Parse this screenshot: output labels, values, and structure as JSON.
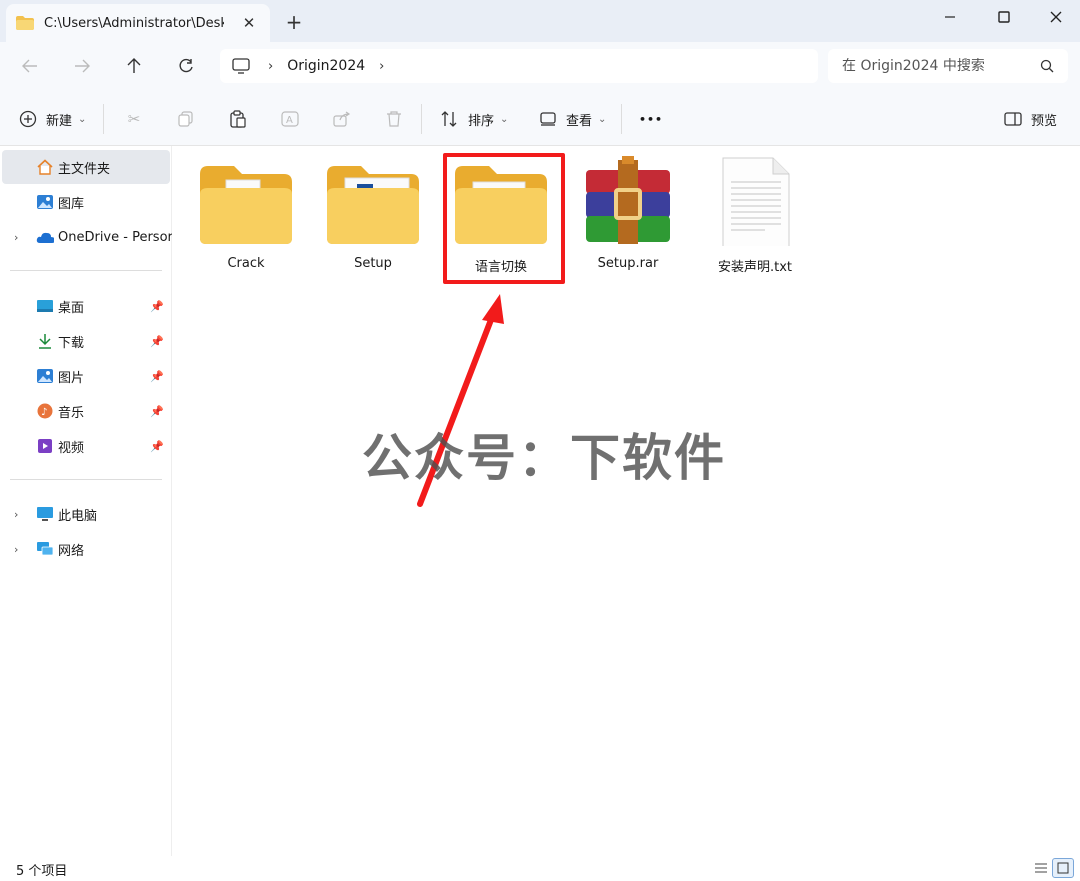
{
  "window": {
    "tab_title": "C:\\Users\\Administrator\\Deskto",
    "new_tab": "+",
    "close_tab": "✕",
    "minimize": "—",
    "maximize": "☐",
    "close": "✕"
  },
  "address": {
    "path_segment": "Origin2024",
    "search_placeholder": "在 Origin2024 中搜索"
  },
  "toolbar": {
    "new_label": "新建",
    "sort_label": "排序",
    "view_label": "查看",
    "more_label": "•••",
    "preview_label": "预览"
  },
  "sidebar": {
    "items": [
      {
        "label": "主文件夹",
        "icon": "home-icon"
      },
      {
        "label": "图库",
        "icon": "gallery-icon"
      },
      {
        "label": "OneDrive - Persor",
        "icon": "onedrive-icon"
      },
      {
        "label": "桌面",
        "icon": "desktop-icon"
      },
      {
        "label": "下载",
        "icon": "download-icon"
      },
      {
        "label": "图片",
        "icon": "pictures-icon"
      },
      {
        "label": "音乐",
        "icon": "music-icon"
      },
      {
        "label": "视频",
        "icon": "video-icon"
      },
      {
        "label": "此电脑",
        "icon": "this-pc-icon"
      },
      {
        "label": "网络",
        "icon": "network-icon"
      }
    ]
  },
  "files": [
    {
      "name": "Crack",
      "type": "folder"
    },
    {
      "name": "Setup",
      "type": "folder"
    },
    {
      "name": "语言切换",
      "type": "folder"
    },
    {
      "name": "Setup.rar",
      "type": "rar"
    },
    {
      "name": "安装声明.txt",
      "type": "txt"
    }
  ],
  "watermark": "公众号：下软件",
  "status": {
    "item_count": "5 个项目"
  },
  "colors": {
    "highlight": "#f21b1b",
    "folder": "#f5c64c",
    "accent": "#0067c0"
  }
}
